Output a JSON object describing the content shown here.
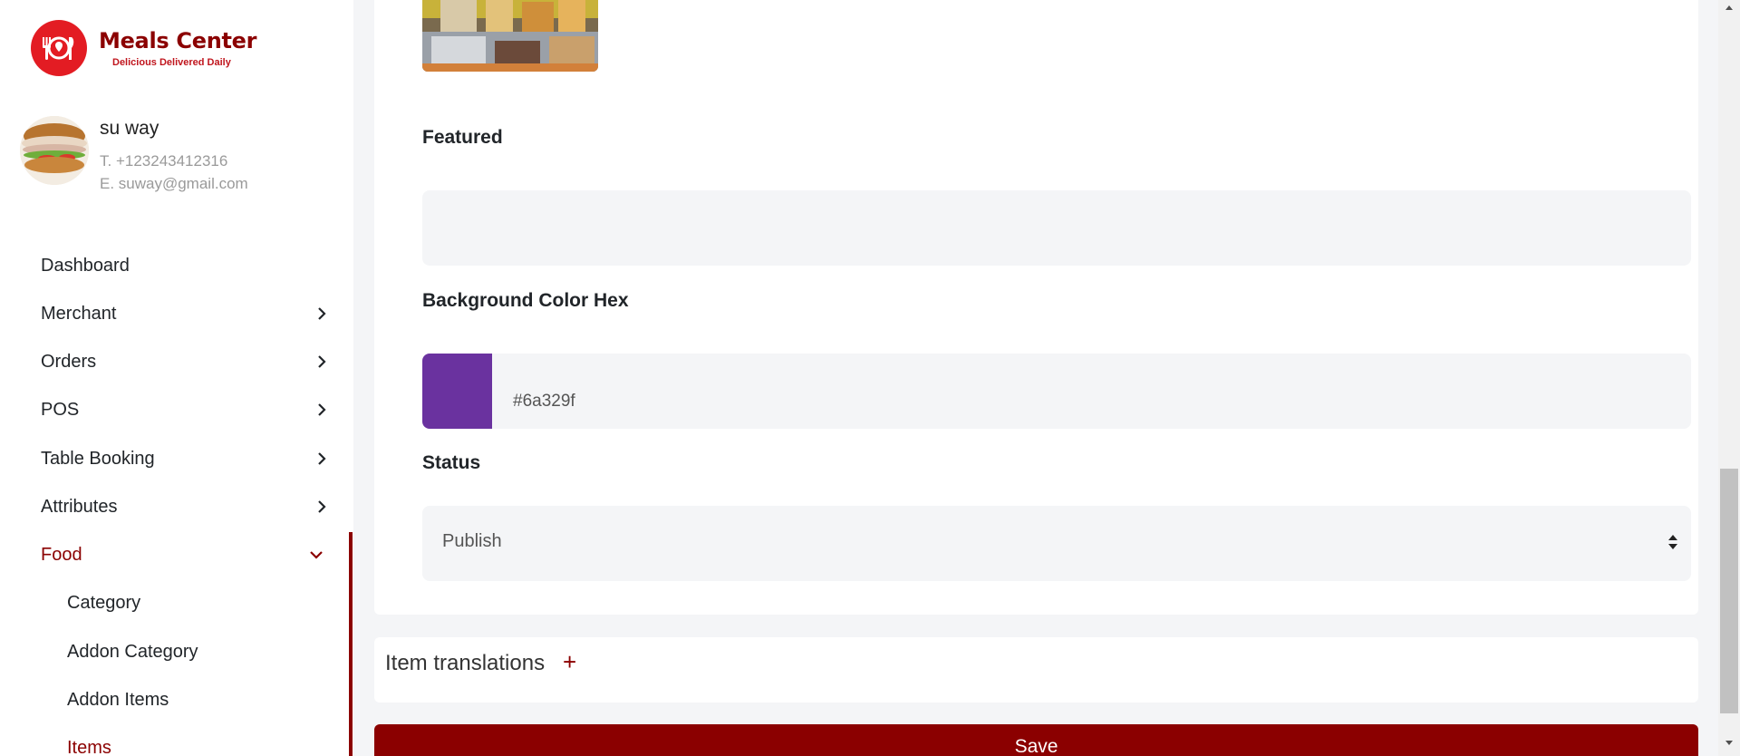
{
  "brand": {
    "name": "Meals Center",
    "tagline": "Delicious Delivered Daily"
  },
  "profile": {
    "name": "su way",
    "phone": "T. +123243412316",
    "email": "E. suway@gmail.com"
  },
  "nav": {
    "dashboard": "Dashboard",
    "merchant": "Merchant",
    "orders": "Orders",
    "pos": "POS",
    "table_booking": "Table Booking",
    "attributes": "Attributes",
    "food": "Food",
    "food_sub": {
      "category": "Category",
      "addon_category": "Addon Category",
      "addon_items": "Addon Items",
      "items": "Items"
    }
  },
  "form": {
    "featured_label": "Featured",
    "featured_value": "",
    "bg_color_label": "Background Color Hex",
    "bg_color_value": "#6a329f",
    "status_label": "Status",
    "status_value": "Publish"
  },
  "translations": {
    "label": "Item translations",
    "add_symbol": "+"
  },
  "save_label": "Save",
  "colors": {
    "accent": "#8b0000",
    "logo_red": "#e31c23",
    "swatch": "#6a329f"
  }
}
